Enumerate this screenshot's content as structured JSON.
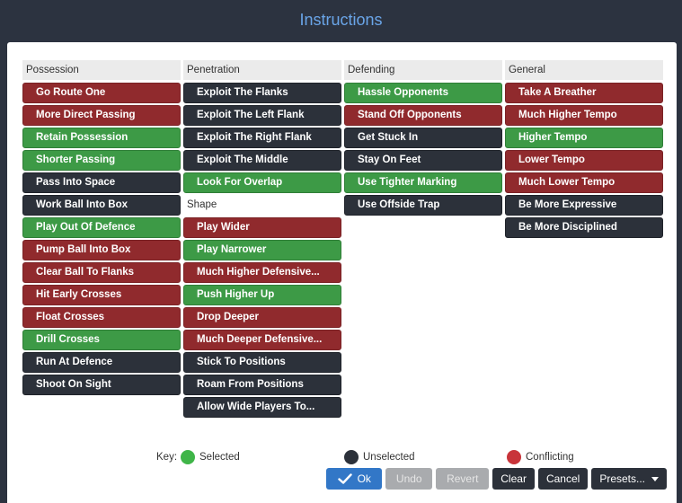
{
  "window": {
    "title": "Instructions"
  },
  "colors": {
    "selected": "#3d9a46",
    "unselected": "#2c313a",
    "conflicting": "#902a2d",
    "accent": "#3277c7"
  },
  "columns": [
    {
      "header": "Possession",
      "items": [
        {
          "label": "Go Route One",
          "state": "conflicting"
        },
        {
          "label": "More Direct Passing",
          "state": "conflicting"
        },
        {
          "label": "Retain Possession",
          "state": "selected"
        },
        {
          "label": "Shorter Passing",
          "state": "selected"
        },
        {
          "label": "Pass Into Space",
          "state": "unselected"
        },
        {
          "label": "Work Ball Into Box",
          "state": "unselected"
        },
        {
          "label": "Play Out Of Defence",
          "state": "selected"
        },
        {
          "label": "Pump Ball Into Box",
          "state": "conflicting"
        },
        {
          "label": "Clear Ball To Flanks",
          "state": "conflicting"
        },
        {
          "label": "Hit Early Crosses",
          "state": "conflicting"
        },
        {
          "label": "Float Crosses",
          "state": "conflicting"
        },
        {
          "label": "Drill Crosses",
          "state": "selected"
        },
        {
          "label": "Run At Defence",
          "state": "unselected"
        },
        {
          "label": "Shoot On Sight",
          "state": "unselected"
        }
      ]
    },
    {
      "header": "Penetration",
      "items": [
        {
          "label": "Exploit The Flanks",
          "state": "unselected"
        },
        {
          "label": "Exploit The Left Flank",
          "state": "unselected"
        },
        {
          "label": "Exploit The Right Flank",
          "state": "unselected"
        },
        {
          "label": "Exploit The Middle",
          "state": "unselected"
        },
        {
          "label": "Look For Overlap",
          "state": "selected"
        }
      ],
      "subheader": "Shape",
      "subitems": [
        {
          "label": "Play Wider",
          "state": "conflicting"
        },
        {
          "label": "Play Narrower",
          "state": "selected"
        },
        {
          "label": "Much Higher Defensive...",
          "state": "conflicting"
        },
        {
          "label": "Push Higher Up",
          "state": "selected"
        },
        {
          "label": "Drop Deeper",
          "state": "conflicting"
        },
        {
          "label": "Much Deeper Defensive...",
          "state": "conflicting"
        },
        {
          "label": "Stick To Positions",
          "state": "unselected"
        },
        {
          "label": "Roam From Positions",
          "state": "unselected"
        },
        {
          "label": "Allow Wide Players To...",
          "state": "unselected"
        }
      ]
    },
    {
      "header": "Defending",
      "items": [
        {
          "label": "Hassle Opponents",
          "state": "selected"
        },
        {
          "label": "Stand Off Opponents",
          "state": "conflicting"
        },
        {
          "label": "Get Stuck In",
          "state": "unselected"
        },
        {
          "label": "Stay On Feet",
          "state": "unselected"
        },
        {
          "label": "Use Tighter Marking",
          "state": "selected"
        },
        {
          "label": "Use Offside Trap",
          "state": "unselected"
        }
      ]
    },
    {
      "header": "General",
      "items": [
        {
          "label": "Take A Breather",
          "state": "conflicting"
        },
        {
          "label": "Much Higher Tempo",
          "state": "conflicting"
        },
        {
          "label": "Higher Tempo",
          "state": "selected"
        },
        {
          "label": "Lower Tempo",
          "state": "conflicting"
        },
        {
          "label": "Much Lower Tempo",
          "state": "conflicting"
        },
        {
          "label": "Be More Expressive",
          "state": "unselected"
        },
        {
          "label": "Be More Disciplined",
          "state": "unselected"
        }
      ]
    }
  ],
  "key": {
    "label": "Key:",
    "selected_label": "Selected",
    "unselected_label": "Unselected",
    "conflicting_label": "Conflicting"
  },
  "footer": {
    "ok_label": "Ok",
    "undo_label": "Undo",
    "revert_label": "Revert",
    "clear_label": "Clear",
    "cancel_label": "Cancel",
    "presets_label": "Presets...",
    "ok_icon": "check-icon",
    "presets_icon": "caret-down-icon"
  }
}
